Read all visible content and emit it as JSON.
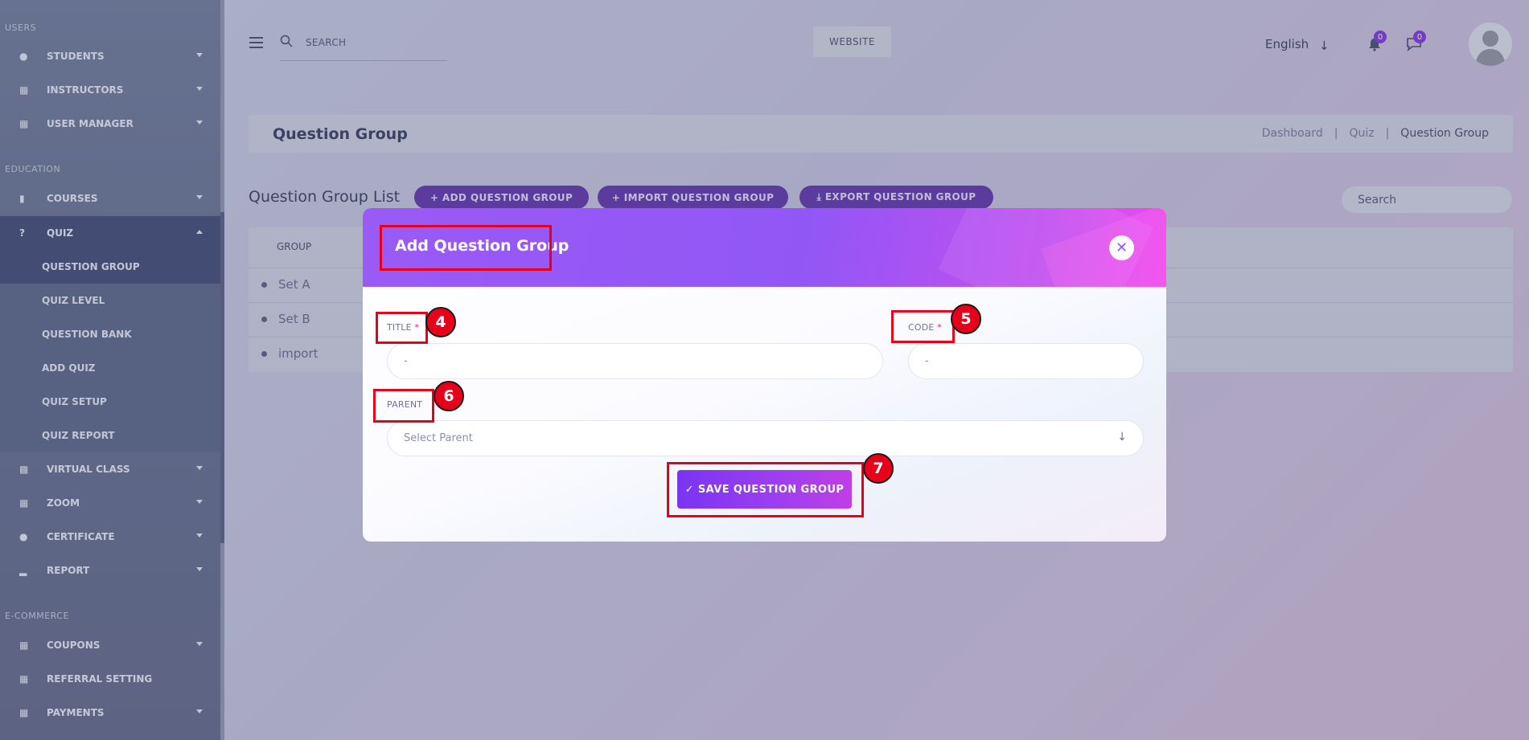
{
  "sidebar": {
    "sections": {
      "users": "USERS",
      "education": "EDUCATION",
      "ecommerce": "E-COMMERCE"
    },
    "items": {
      "students": "STUDENTS",
      "instructors": "INSTRUCTORS",
      "user_manager": "USER MANAGER",
      "courses": "COURSES",
      "quiz": "QUIZ",
      "question_group": "QUESTION GROUP",
      "quiz_level": "QUIZ LEVEL",
      "question_bank": "QUESTION BANK",
      "add_quiz": "ADD QUIZ",
      "quiz_setup": "QUIZ SETUP",
      "quiz_report": "QUIZ REPORT",
      "virtual_class": "VIRTUAL CLASS",
      "zoom": "ZOOM",
      "certificate": "CERTIFICATE",
      "report": "REPORT",
      "coupons": "COUPONS",
      "referral_setting": "REFERRAL SETTING",
      "payments": "PAYMENTS"
    }
  },
  "header": {
    "search_label": "SEARCH",
    "website_button": "WEBSITE",
    "language": "English",
    "notifications_count": "0",
    "messages_count": "0"
  },
  "page": {
    "title": "Question Group",
    "breadcrumb": [
      "Dashboard",
      "|",
      "Quiz",
      "|",
      "Question Group"
    ],
    "list_title": "Question Group List",
    "add_button": "+ ADD QUESTION GROUP",
    "import_button": "+ IMPORT QUESTION GROUP",
    "export_button": "⤓ EXPORT QUESTION GROUP",
    "list_search": "Search",
    "table": {
      "column_header": "GROUP",
      "rows": [
        "Set A",
        "Set B",
        "import"
      ]
    }
  },
  "modal": {
    "title": "Add Question Group",
    "title_label": "TITLE",
    "code_label": "CODE",
    "required_marker": "*",
    "title_value": "-",
    "code_value": "-",
    "parent_label": "PARENT",
    "parent_placeholder": "Select Parent",
    "save_button": "✓  SAVE QUESTION GROUP"
  },
  "annotations": [
    "4",
    "5",
    "6",
    "7"
  ],
  "colors": {
    "accent": "#7b2fd6",
    "modal_header": "#9a5af6",
    "annotation_red": "#e8001b"
  }
}
